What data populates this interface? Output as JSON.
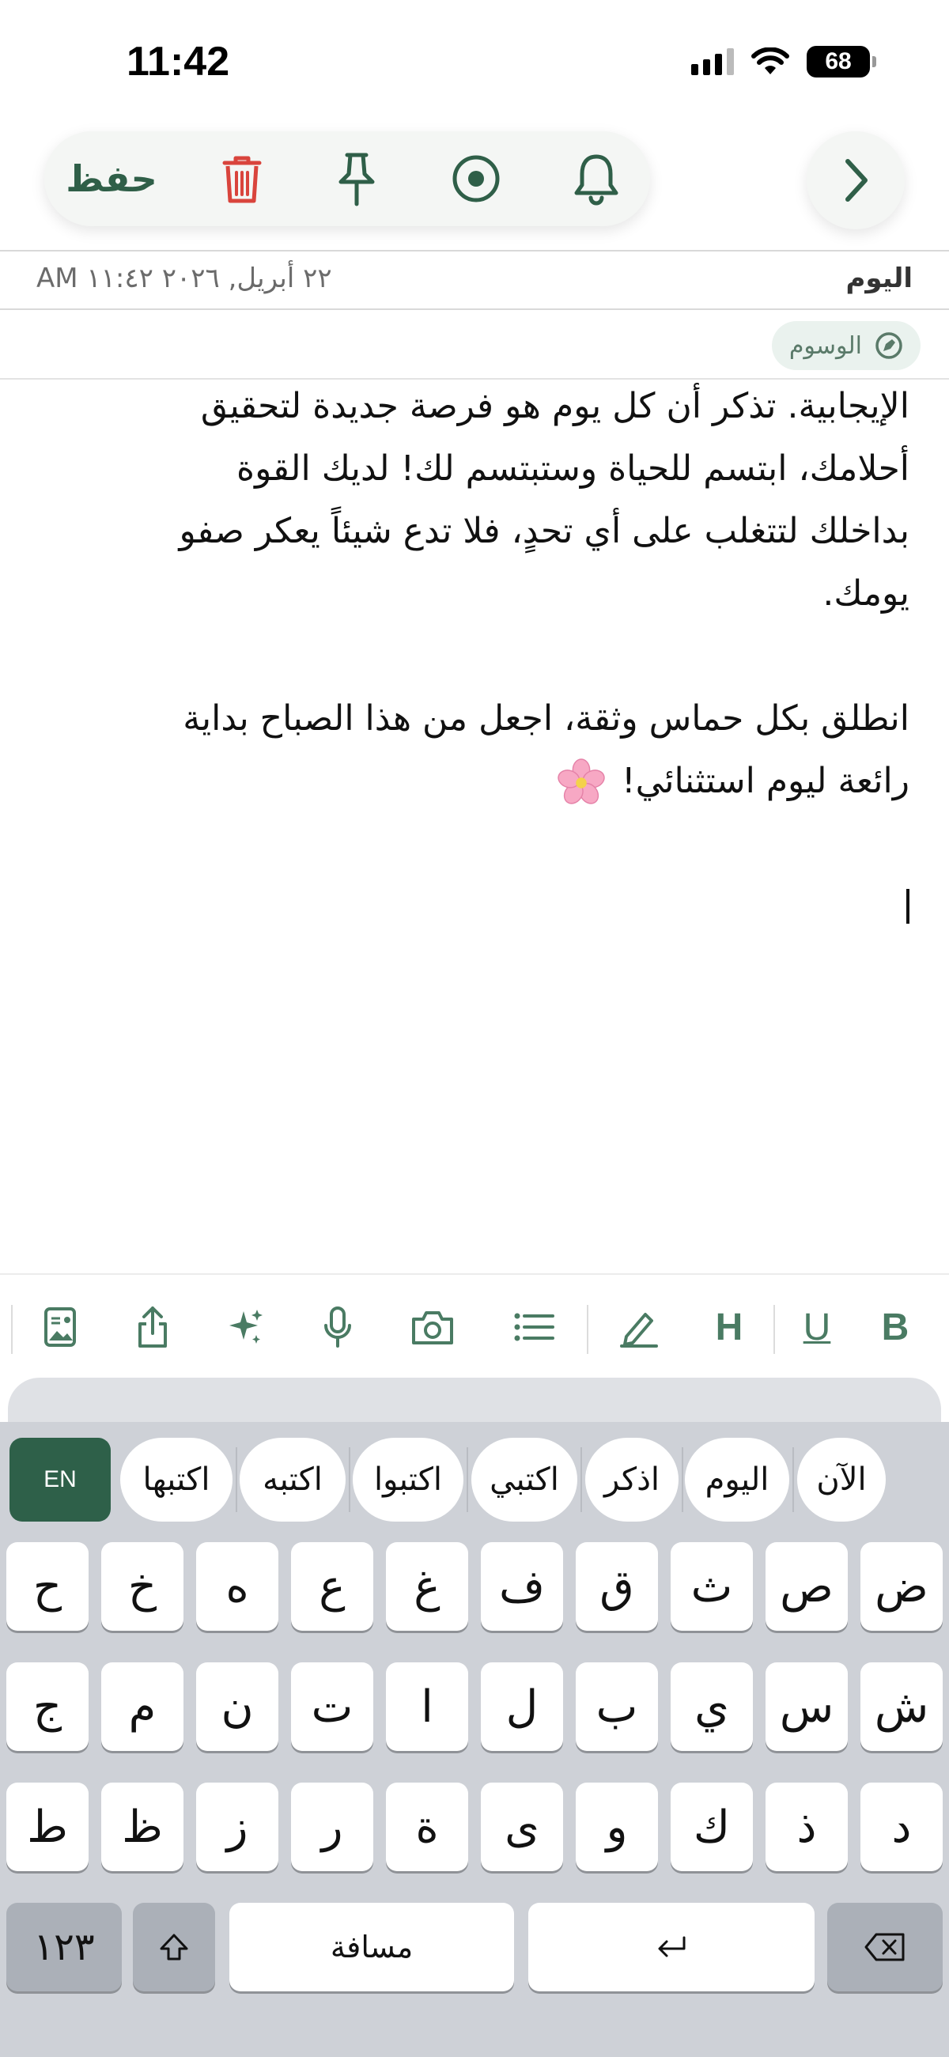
{
  "status_bar": {
    "time": "11:42",
    "battery": "68"
  },
  "toolbar": {
    "save_label": "حفظ",
    "icons": [
      "trash-icon",
      "pin-icon",
      "record-icon",
      "bell-icon",
      "chevron-right-icon"
    ],
    "delete_color": "#d9443c",
    "accent_color": "#2f5f48"
  },
  "date_row": {
    "datetime": "٢٢ أبريل, ٢٠٢٦ ١١:٤٢ AM",
    "day": "اليوم"
  },
  "tags": {
    "label": "الوسوم"
  },
  "note": {
    "paragraph1": [
      "الإيجابية. تذكر أن كل يوم هو فرصة جديدة لتحقيق",
      "أحلامك، ابتسم للحياة وستبتسم لك! لديك القوة",
      "بداخلك لتتغلب على أي تحدٍ، فلا تدع شيئاً يعكر صفو",
      "يومك."
    ],
    "paragraph2": [
      "انطلق بكل حماس وثقة، اجعل من هذا الصباح بداية",
      "رائعة ليوم استثنائي!"
    ],
    "emoji": "cherry-blossom"
  },
  "format_bar": {
    "items": [
      "image-text-icon",
      "share-icon",
      "sparkle-icon",
      "microphone-icon",
      "camera-icon",
      "list-icon",
      "pen-icon",
      "H",
      "U",
      "B"
    ]
  },
  "keyboard": {
    "lang": "EN",
    "suggestions": [
      "اكتبها",
      "اكتبه",
      "اكتبوا",
      "اكتبي",
      "اذكر",
      "اليوم",
      "الآن"
    ],
    "row1": [
      "ح",
      "خ",
      "ه",
      "ع",
      "غ",
      "ف",
      "ق",
      "ث",
      "ص",
      "ض"
    ],
    "row2": [
      "ج",
      "م",
      "ن",
      "ت",
      "ا",
      "ل",
      "ب",
      "ي",
      "س",
      "ش"
    ],
    "row3": [
      "ط",
      "ظ",
      "ز",
      "ر",
      "ة",
      "ى",
      "و",
      "ك",
      "ذ",
      "د"
    ],
    "numbers_key": "١٢٣",
    "space_label": "مسافة"
  }
}
